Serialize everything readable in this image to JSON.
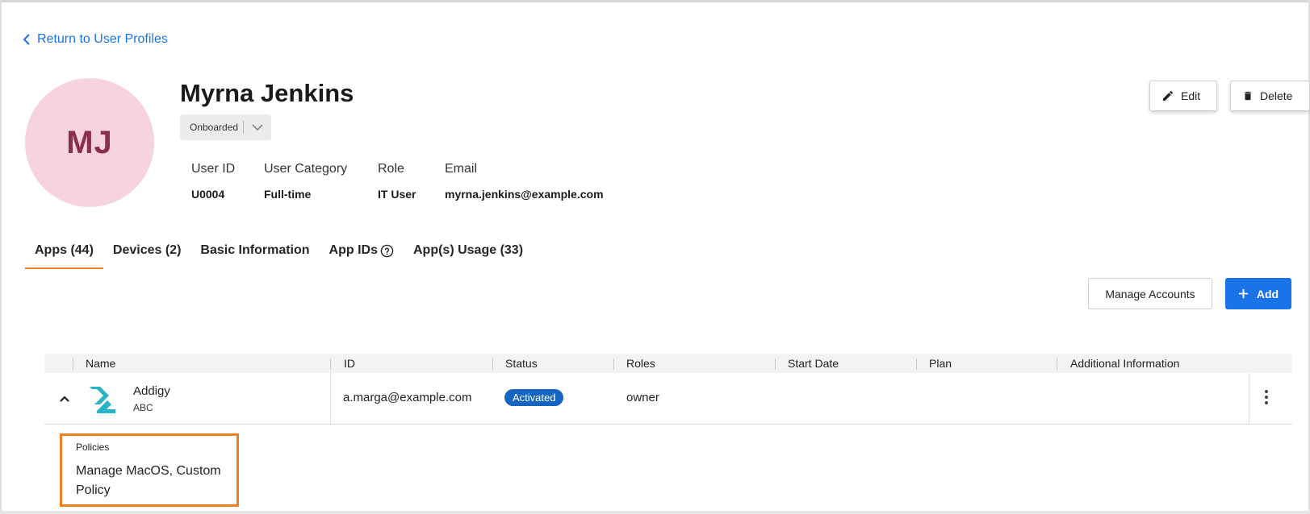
{
  "nav": {
    "back_label": "Return to User Profiles"
  },
  "profile": {
    "initials": "MJ",
    "name": "Myrna Jenkins",
    "status": "Onboarded",
    "colors": {
      "avatar_bg": "#f6d3de",
      "avatar_text": "#8b2f4e"
    }
  },
  "info": {
    "user_id_label": "User ID",
    "user_id": "U0004",
    "category_label": "User Category",
    "category": "Full-time",
    "role_label": "Role",
    "role": "IT User",
    "email_label": "Email",
    "email": "myrna.jenkins@example.com"
  },
  "actions": {
    "edit": "Edit",
    "delete": "Delete",
    "manage_accounts": "Manage Accounts",
    "add": "Add"
  },
  "tabs": [
    {
      "label": "Apps (44)",
      "active": true
    },
    {
      "label": "Devices (2)"
    },
    {
      "label": "Basic Information"
    },
    {
      "label": "App IDs",
      "icon": "help-circle-icon"
    },
    {
      "label": "App(s) Usage (33)"
    }
  ],
  "table": {
    "columns": [
      "Name",
      "ID",
      "Status",
      "Roles",
      "Start Date",
      "Plan",
      "Additional Information"
    ],
    "rows": [
      {
        "name": "Addigy",
        "org": "ABC",
        "id": "a.marga@example.com",
        "status": "Activated",
        "roles": "owner",
        "start_date": "",
        "plan": "",
        "additional": ""
      }
    ]
  },
  "expanded": {
    "title": "Policies",
    "value": "Manage MacOS, Custom Policy"
  },
  "theme": {
    "accent": "#ef7d22",
    "primary": "#1a73e8",
    "badge": "#1565c0"
  }
}
